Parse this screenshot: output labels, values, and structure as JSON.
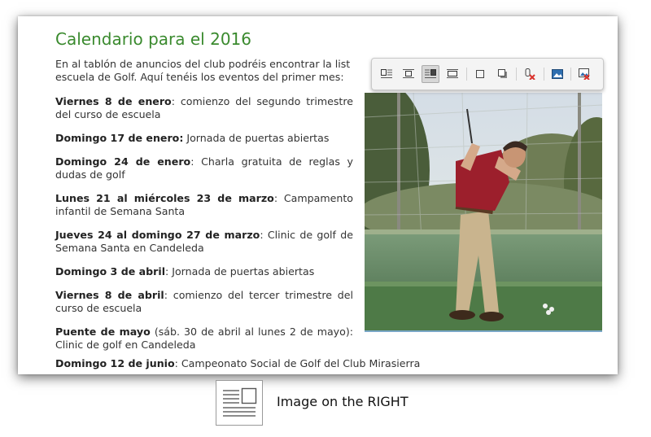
{
  "article": {
    "title": "Calendario para el 2016",
    "intro_line1": "En al tablón de anuncios del club podréis encontrar la list",
    "intro_line2": "escuela de Golf. Aquí tenéis los eventos del primer mes:",
    "events": [
      {
        "date": "Viernes 8 de enero",
        "sep": ": ",
        "text": "comienzo del segundo trimestre del curso de escuela"
      },
      {
        "date": "Domingo 17 de enero:",
        "sep": " ",
        "text": "Jornada de puertas abiertas"
      },
      {
        "date": "Domingo 24 de enero",
        "sep": ": ",
        "text": "Charla gratuita de reglas y dudas de golf"
      },
      {
        "date": "Lunes 21 al miércoles 23 de marzo",
        "sep": ": ",
        "text": "Campamento infantil de Semana Santa"
      },
      {
        "date": "Jueves 24 al domingo 27 de marzo",
        "sep": ": ",
        "text": "Clinic de golf de Semana Santa en Candeleda"
      },
      {
        "date": "Domingo 3 de abril",
        "sep": ": ",
        "text": "Jornada de puertas abiertas"
      },
      {
        "date": "Viernes 8 de abril",
        "sep": ": ",
        "text": "comienzo del tercer trimestre del curso de escuela"
      },
      {
        "date": "Puente de mayo",
        "sep": " ",
        "text": "(sáb. 30 de abril al lunes 2 de mayo): Clinic de golf en Candeleda"
      }
    ],
    "last_event": {
      "date": "Domingo 12 de junio",
      "sep": ": ",
      "text": "Campeonato Social de Golf del Club Mirasierra"
    }
  },
  "toolbar": {
    "buttons": [
      {
        "name": "align-inline-left-button",
        "icon": "align-inline-left-icon",
        "active": false
      },
      {
        "name": "align-center-button",
        "icon": "align-center-icon",
        "active": false
      },
      {
        "name": "align-right-button",
        "icon": "align-right-icon",
        "active": true
      },
      {
        "name": "align-block-button",
        "icon": "align-block-icon",
        "active": false
      },
      {
        "name": "frame-button",
        "icon": "frame-icon",
        "active": false
      },
      {
        "name": "shadow-button",
        "icon": "shadow-icon",
        "active": false
      },
      {
        "name": "remove-link-button",
        "icon": "remove-link-icon",
        "active": false
      },
      {
        "name": "edit-image-button",
        "icon": "image-icon",
        "active": false
      },
      {
        "name": "remove-image-button",
        "icon": "remove-image-icon",
        "active": false
      }
    ]
  },
  "caption": "Image on the RIGHT",
  "colors": {
    "title": "#3a8a2e",
    "toolbar_bg": "#f4f4f4",
    "remove": "#d9312b"
  }
}
